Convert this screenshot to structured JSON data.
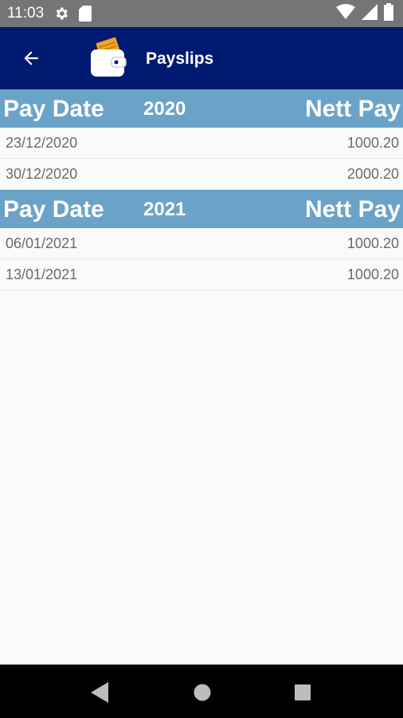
{
  "status_bar": {
    "time": "11:03",
    "left_icons": [
      "gear-icon",
      "sd-card-icon"
    ],
    "right_icons": [
      "wifi-icon",
      "signal-icon",
      "battery-icon"
    ]
  },
  "app_bar": {
    "title": "Payslips",
    "back_icon": "arrow-back-icon",
    "logo_icon": "wallet-icon",
    "background": "#001a72"
  },
  "groups": [
    {
      "left_header": "Pay Date",
      "year": "2020",
      "right_header": "Nett Pay",
      "rows": [
        {
          "date": "23/12/2020",
          "amount": "1000.20"
        },
        {
          "date": "30/12/2020",
          "amount": "2000.20"
        }
      ]
    },
    {
      "left_header": "Pay Date",
      "year": "2021",
      "right_header": "Nett Pay",
      "rows": [
        {
          "date": "06/01/2021",
          "amount": "1000.20"
        },
        {
          "date": "13/01/2021",
          "amount": "1000.20"
        }
      ]
    }
  ],
  "colors": {
    "header_band": "#6ba3c8",
    "status_bar": "#757575",
    "nav_bar": "#000000"
  },
  "nav_bar": {
    "buttons": [
      "back-triangle-icon",
      "home-circle-icon",
      "recents-square-icon"
    ]
  }
}
